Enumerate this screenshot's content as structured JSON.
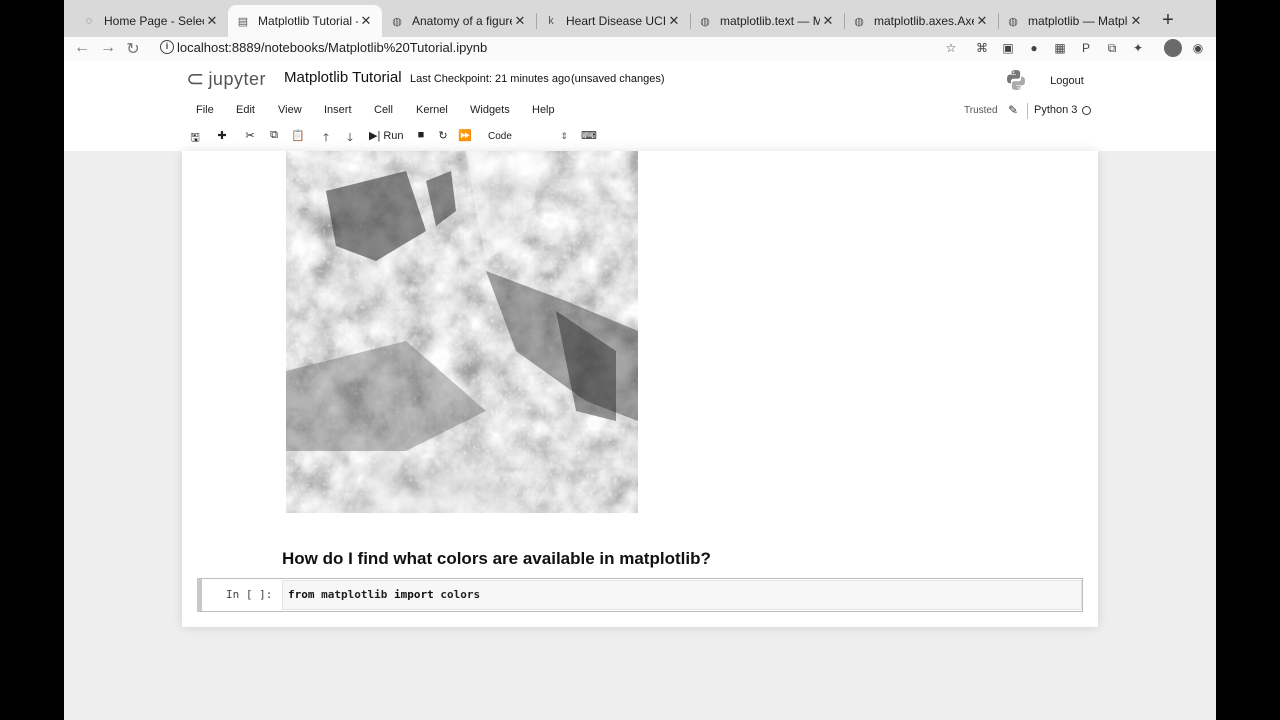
{
  "browser": {
    "tabs": [
      {
        "title": "Home Page - Select o",
        "icon": "loading-icon",
        "active": false
      },
      {
        "title": "Matplotlib Tutorial - J",
        "icon": "jupyter-doc-icon",
        "active": true
      },
      {
        "title": "Anatomy of a figure",
        "icon": "matplotlib-icon",
        "active": false
      },
      {
        "title": "Heart Disease UCI | K",
        "icon": "kaggle-icon",
        "active": false
      },
      {
        "title": "matplotlib.text — Mat",
        "icon": "matplotlib-icon",
        "active": false
      },
      {
        "title": "matplotlib.axes.Axes.t",
        "icon": "matplotlib-icon",
        "active": false
      },
      {
        "title": "matplotlib — Matplotl",
        "icon": "matplotlib-icon",
        "active": false
      }
    ],
    "new_tab": "+",
    "url": "localhost:8889/notebooks/Matplotlib%20Tutorial.ipynb"
  },
  "jupyter": {
    "logo_text": "jupyter",
    "notebook_title": "Matplotlib Tutorial",
    "checkpoint": "Last Checkpoint: 21 minutes ago",
    "unsaved": "(unsaved changes)",
    "logout": "Logout",
    "menu": [
      "File",
      "Edit",
      "View",
      "Insert",
      "Cell",
      "Kernel",
      "Widgets",
      "Help"
    ],
    "trusted": "Trusted",
    "kernel": "Python 3",
    "run_label": "Run",
    "cell_type": "Code"
  },
  "notebook": {
    "heading": "How do I find what colors are available in matplotlib?",
    "prompt": "In [ ]:",
    "code_kw1": "from",
    "code_mod": "matplotlib",
    "code_kw2": "import",
    "code_name": "colors"
  }
}
